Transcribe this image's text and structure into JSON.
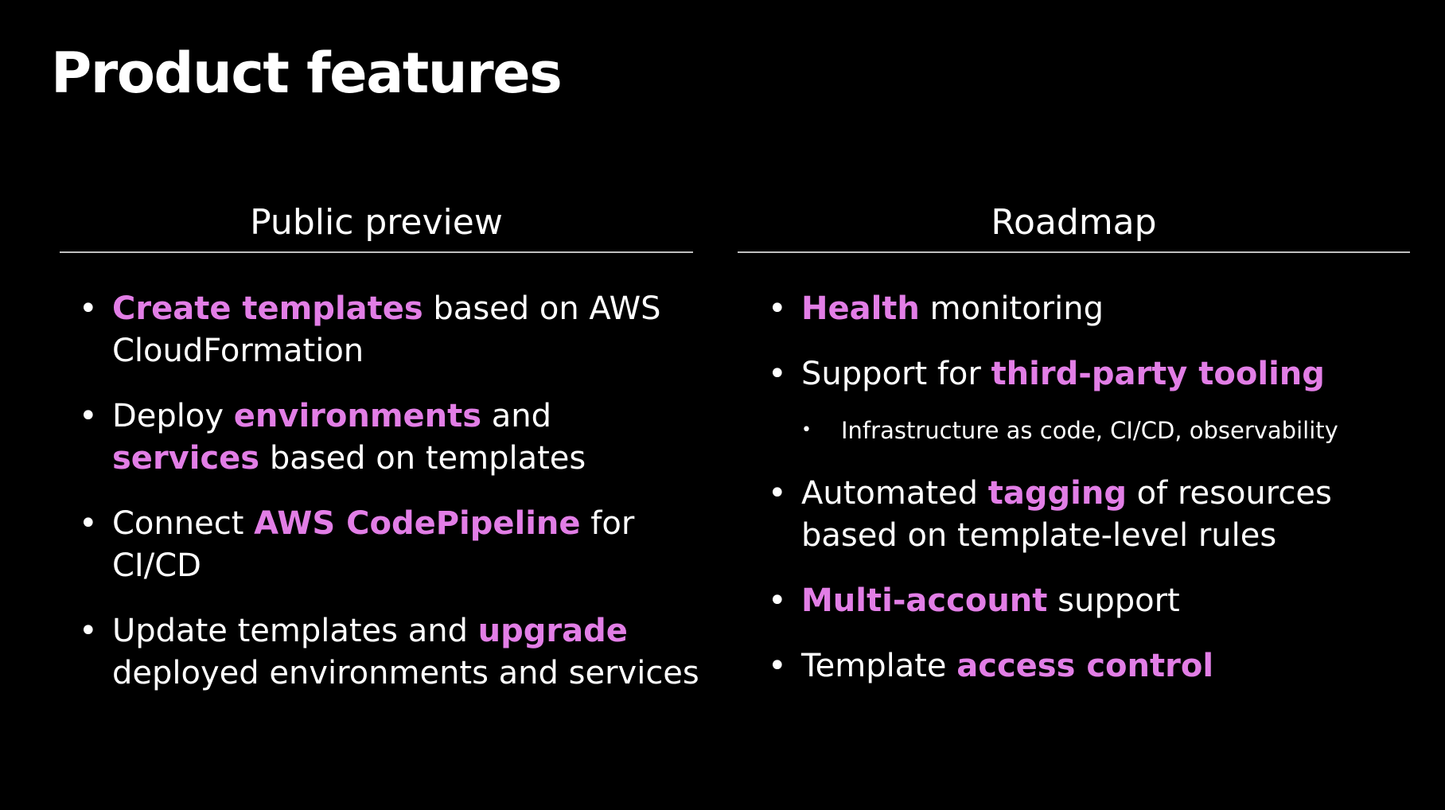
{
  "title": "Product features",
  "colors": {
    "background": "#000000",
    "text": "#ffffff",
    "highlight": "#e27ee6",
    "rule": "#bfbfbf"
  },
  "left": {
    "heading": "Public preview",
    "bullet": "•",
    "items": [
      {
        "hl1": "Create templates",
        "t1": " based on AWS CloudFormation"
      },
      {
        "t0": "Deploy ",
        "hl1": "environments",
        "t1": " and ",
        "hl2": "services",
        "t2": " based on templates"
      },
      {
        "t0": "Connect ",
        "hl1": "AWS CodePipeline",
        "t1": " for CI/CD"
      },
      {
        "t0": "Update templates and ",
        "hl1": "upgrade",
        "t1": " deployed environments and services"
      }
    ]
  },
  "right": {
    "heading": "Roadmap",
    "bullet": "•",
    "items": [
      {
        "hl1": "Health",
        "t1": " monitoring"
      },
      {
        "t0": "Support for ",
        "hl1": "third-party tooling"
      },
      {
        "sub": "Infrastructure as code, CI/CD, observability"
      },
      {
        "t0": "Automated ",
        "hl1": "tagging",
        "t1": " of resources based on template-level rules"
      },
      {
        "hl1": "Multi-account",
        "t1": " support"
      },
      {
        "t0": "Template ",
        "hl1": "access control"
      }
    ]
  }
}
